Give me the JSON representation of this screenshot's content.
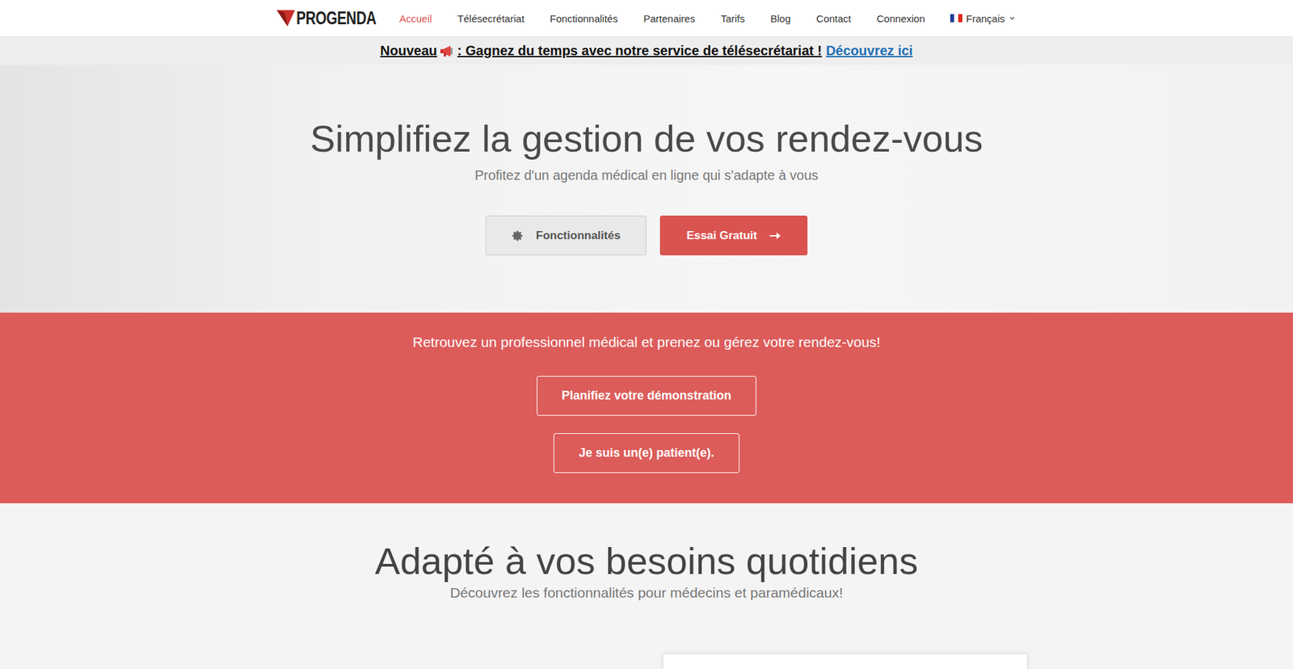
{
  "nav": {
    "logo": "PROGENDA",
    "items": [
      {
        "label": "Accueil",
        "selected": true
      },
      {
        "label": "Télésecrétariat",
        "selected": false
      },
      {
        "label": "Fonctionnalités",
        "selected": false
      },
      {
        "label": "Partenaires",
        "selected": false
      },
      {
        "label": "Tarifs",
        "selected": false
      },
      {
        "label": "Blog",
        "selected": false
      },
      {
        "label": "Contact",
        "selected": false
      },
      {
        "label": "Connexion",
        "selected": false
      }
    ],
    "language": "Français"
  },
  "announcement": {
    "badge": "Nouveau",
    "text": ": Gagnez du temps avec notre service de télésecrétariat !",
    "link": "Découvrez ici"
  },
  "hero": {
    "title": "Simplifiez la gestion de vos rendez-vous",
    "subtitle": "Profitez d'un agenda médical en ligne qui s'adapte à vous",
    "buttons": [
      {
        "label": "Fonctionnalités",
        "kind": "secondary"
      },
      {
        "label": "Essai Gratuit",
        "kind": "primary"
      }
    ]
  },
  "patient_band": {
    "text": "Retrouvez un professionnel médical et prenez ou gérez votre rendez-vous!",
    "buttons": [
      "Planifiez votre démonstration",
      "Je suis un(e) patient(e)."
    ]
  },
  "features": {
    "title": "Adapté à vos besoins quotidiens",
    "subtitle": "Découvrez les fonctionnalités pour médecins et paramédicaux!"
  }
}
